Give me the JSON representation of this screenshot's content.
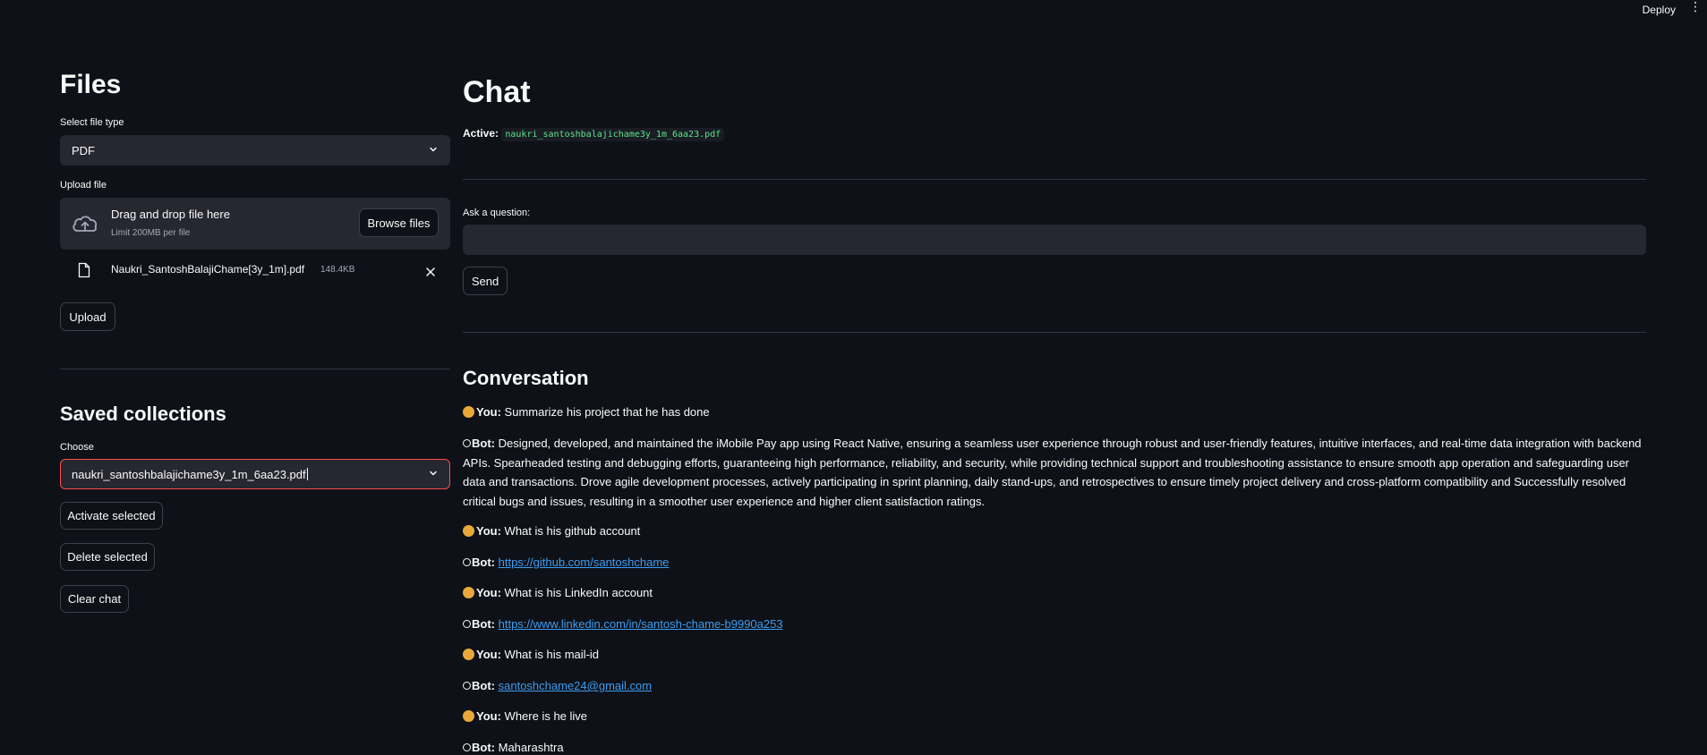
{
  "topbar": {
    "deploy_label": "Deploy",
    "menu_icon": "kebab-menu-icon"
  },
  "files": {
    "title": "Files",
    "file_type_label": "Select file type",
    "file_type_value": "PDF",
    "upload_label": "Upload file",
    "dropzone_title": "Drag and drop file here",
    "dropzone_limit": "Limit 200MB per file",
    "browse_label": "Browse files",
    "uploaded_file_name": "Naukri_SantoshBalajiChame[3y_1m].pdf",
    "uploaded_file_size": "148.4KB",
    "upload_button": "Upload"
  },
  "collections": {
    "title": "Saved collections",
    "choose_label": "Choose",
    "choose_value": "naukri_santoshbalajichame3y_1m_6aa23.pdf",
    "activate_button": "Activate selected",
    "delete_button": "Delete selected",
    "clear_button": "Clear chat"
  },
  "chat": {
    "title": "Chat",
    "active_label": "Active:",
    "active_value": "naukri_santoshbalajichame3y_1m_6aa23.pdf",
    "question_label": "Ask a question:",
    "question_value": "",
    "send_button": "Send"
  },
  "conversation": {
    "title": "Conversation",
    "you_label": "You:",
    "bot_label": "Bot:",
    "messages": [
      {
        "role": "you",
        "text": "Summarize his project that he has done"
      },
      {
        "role": "bot",
        "text": "Designed, developed, and maintained the iMobile Pay app using React Native, ensuring a seamless user experience through robust and user-friendly features, intuitive interfaces, and real-time data integration with backend APIs. Spearheaded testing and debugging efforts, guaranteeing high performance, reliability, and security, while providing technical support and troubleshooting assistance to ensure smooth app operation and safeguarding user data and transactions. Drove agile development processes, actively participating in sprint planning, daily stand-ups, and retrospectives to ensure timely project delivery and cross-platform compatibility and Successfully resolved critical bugs and issues, resulting in a smoother user experience and higher client satisfaction ratings."
      },
      {
        "role": "you",
        "text": "What is his github account"
      },
      {
        "role": "bot",
        "link": "https://github.com/santoshchame"
      },
      {
        "role": "you",
        "text": "What is his LinkedIn account"
      },
      {
        "role": "bot",
        "link": "https://www.linkedin.com/in/santosh-chame-b9990a253"
      },
      {
        "role": "you",
        "text": "What is his mail-id"
      },
      {
        "role": "bot",
        "link": "santoshchame24@gmail.com"
      },
      {
        "role": "you",
        "text": "Where is he live"
      },
      {
        "role": "bot",
        "text": "Maharashtra"
      }
    ]
  },
  "colors": {
    "background": "#0e1117",
    "input_bg": "#262730",
    "focus_border": "#ff4b4b",
    "link": "#3d9df3",
    "code_text": "#5ce488"
  }
}
